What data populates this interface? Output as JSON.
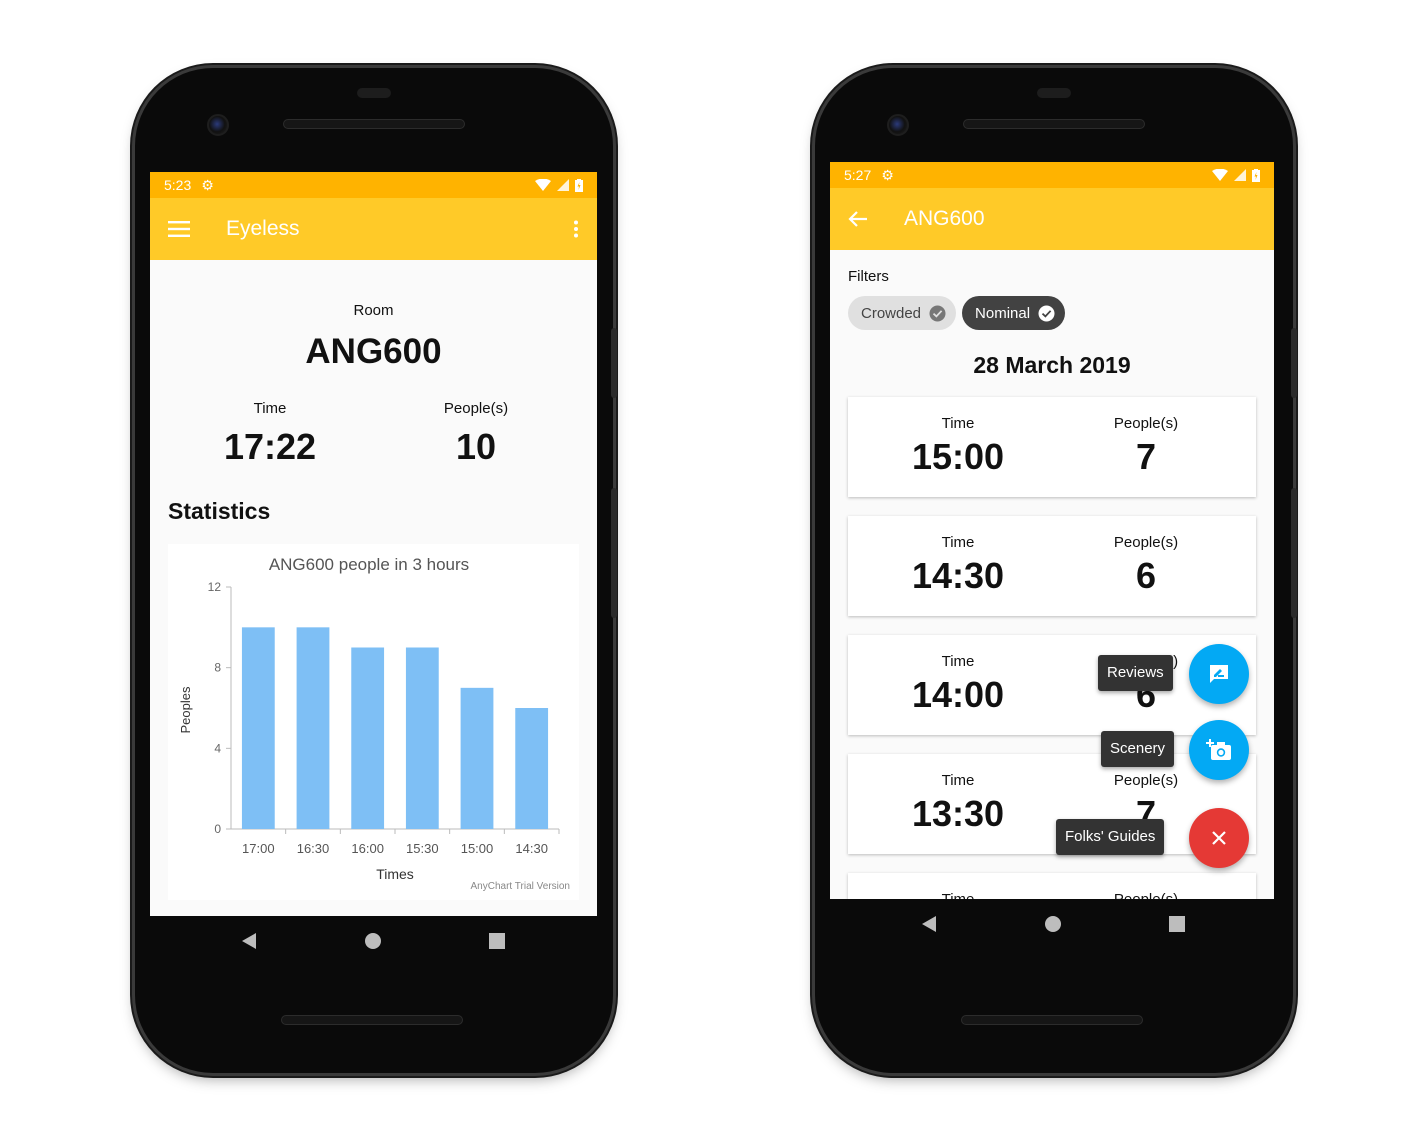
{
  "phone1": {
    "status_time": "5:23",
    "app_title": "Eyeless",
    "room_label": "Room",
    "room_name": "ANG600",
    "time_label": "Time",
    "time_value": "17:22",
    "people_label": "People(s)",
    "people_value": "10",
    "statistics_title": "Statistics",
    "watermark": "AnyChart Trial Version"
  },
  "chart_data": {
    "type": "bar",
    "title": "ANG600 people in 3 hours",
    "xlabel": "Times",
    "ylabel": "Peoples",
    "categories": [
      "17:00",
      "16:30",
      "16:00",
      "15:30",
      "15:00",
      "14:30"
    ],
    "values": [
      10,
      10,
      9,
      9,
      7,
      6
    ],
    "ylim": [
      0,
      12
    ],
    "yticks": [
      "0",
      "4",
      "8",
      "12"
    ],
    "bar_color": "#7ebff5",
    "grid": false,
    "legend": "none"
  },
  "phone2": {
    "status_time": "5:27",
    "app_title": "ANG600",
    "filters_label": "Filters",
    "chips": [
      {
        "label": "Crowded",
        "selected": false
      },
      {
        "label": "Nominal",
        "selected": true
      }
    ],
    "date": "28 March 2019",
    "records": [
      {
        "time_label": "Time",
        "time": "15:00",
        "people_label": "People(s)",
        "people": "7"
      },
      {
        "time_label": "Time",
        "time": "14:30",
        "people_label": "People(s)",
        "people": "6"
      },
      {
        "time_label": "Time",
        "time": "14:00",
        "people_label": "People(s)",
        "people": "6"
      },
      {
        "time_label": "Time",
        "time": "13:30",
        "people_label": "People(s)",
        "people": "7"
      },
      {
        "time_label": "Time",
        "time": "",
        "people_label": "People(s)",
        "people": ""
      }
    ],
    "fab_menu": {
      "reviews_label": "Reviews",
      "scenery_label": "Scenery",
      "guides_label": "Folks' Guides"
    }
  },
  "colors": {
    "status_bar": "#ffb300",
    "app_bar": "#ffca28",
    "fab_blue": "#03a9f4",
    "fab_red": "#e53935",
    "chart_bar": "#7ebff5"
  }
}
